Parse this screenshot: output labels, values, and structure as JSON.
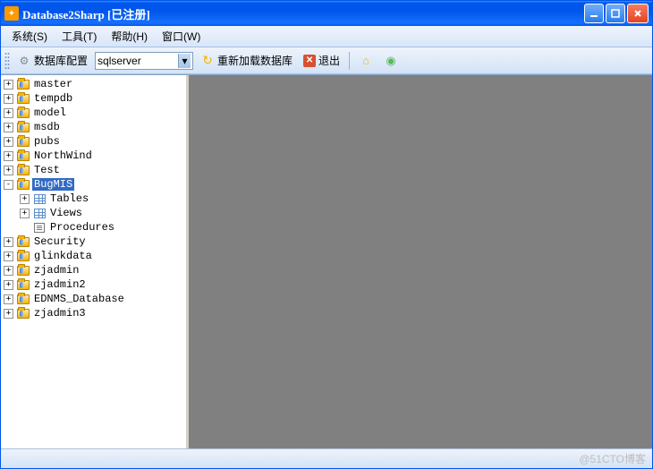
{
  "title": "Database2Sharp [已注册]",
  "menu": {
    "system": "系统(S)",
    "tools": "工具(T)",
    "help": "帮助(H)",
    "window": "窗口(W)"
  },
  "toolbar": {
    "db_config_label": "数据库配置",
    "db_selected": "sqlserver",
    "reload_label": "重新加载数据库",
    "exit_label": "退出"
  },
  "tree": {
    "nodes": [
      {
        "label": "master",
        "type": "db",
        "exp": "+",
        "depth": 0
      },
      {
        "label": "tempdb",
        "type": "db",
        "exp": "+",
        "depth": 0
      },
      {
        "label": "model",
        "type": "db",
        "exp": "+",
        "depth": 0
      },
      {
        "label": "msdb",
        "type": "db",
        "exp": "+",
        "depth": 0
      },
      {
        "label": "pubs",
        "type": "db",
        "exp": "+",
        "depth": 0
      },
      {
        "label": "NorthWind",
        "type": "db",
        "exp": "+",
        "depth": 0
      },
      {
        "label": "Test",
        "type": "db",
        "exp": "+",
        "depth": 0
      },
      {
        "label": "BugMIS",
        "type": "db",
        "exp": "-",
        "depth": 0,
        "selected": true
      },
      {
        "label": "Tables",
        "type": "table",
        "exp": "+",
        "depth": 1
      },
      {
        "label": "Views",
        "type": "table",
        "exp": "+",
        "depth": 1
      },
      {
        "label": "Procedures",
        "type": "proc",
        "exp": "",
        "depth": 1
      },
      {
        "label": "Security",
        "type": "db",
        "exp": "+",
        "depth": 0
      },
      {
        "label": "glinkdata",
        "type": "db",
        "exp": "+",
        "depth": 0
      },
      {
        "label": "zjadmin",
        "type": "db",
        "exp": "+",
        "depth": 0
      },
      {
        "label": "zjadmin2",
        "type": "db",
        "exp": "+",
        "depth": 0
      },
      {
        "label": "EDNMS_Database",
        "type": "db",
        "exp": "+",
        "depth": 0
      },
      {
        "label": "zjadmin3",
        "type": "db",
        "exp": "+",
        "depth": 0
      }
    ]
  },
  "watermark": "@51CTO博客"
}
